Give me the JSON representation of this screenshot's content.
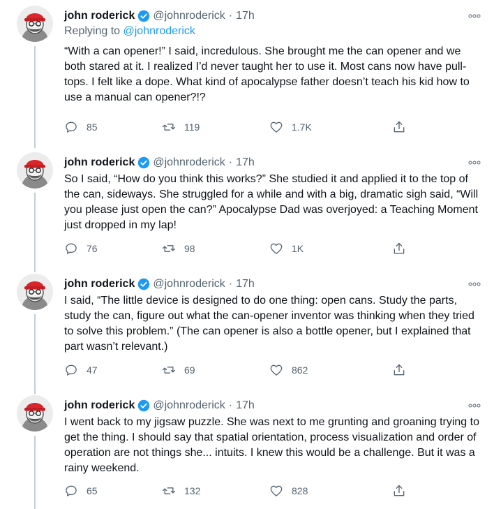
{
  "tweets": [
    {
      "author": "john roderick",
      "handle": "@johnroderick",
      "separator": "·",
      "time": "17h",
      "reply_prefix": "Replying to",
      "reply_to": "@johnroderick",
      "text": "“With a can opener!” I said, incredulous. She brought me the can opener and we both stared at it. I realized I’d never taught her to use it. Most cans now have pull-tops. I felt like a dope. What kind of apocalypse father doesn’t teach his kid how to use a manual can opener?!?",
      "replies": "85",
      "retweets": "119",
      "likes": "1.7K"
    },
    {
      "author": "john roderick",
      "handle": "@johnroderick",
      "separator": "·",
      "time": "17h",
      "text": "So I said, “How do you think this works?” She studied it and applied it to the top of the can, sideways. She struggled for a while and with a big, dramatic sigh said, “Will you please just open the can?” Apocalypse Dad was overjoyed: a Teaching Moment just dropped in my lap!",
      "replies": "76",
      "retweets": "98",
      "likes": "1K"
    },
    {
      "author": "john roderick",
      "handle": "@johnroderick",
      "separator": "·",
      "time": "17h",
      "text": "I said, “The little device is designed to do one thing: open cans. Study the parts, study the can, figure out what the can-opener inventor was thinking when they tried to solve this problem.” (The can opener is also a bottle opener, but I explained that part wasn’t relevant.)",
      "replies": "47",
      "retweets": "69",
      "likes": "862"
    },
    {
      "author": "john roderick",
      "handle": "@johnroderick",
      "separator": "·",
      "time": "17h",
      "text": "I went back to my jigsaw puzzle. She was next to me grunting and groaning trying to get the thing. I should say that spatial orientation, process visualization and order of operation are not things she... intuits. I knew this would be a challenge. But it was a rainy weekend.",
      "replies": "65",
      "retweets": "132",
      "likes": "828"
    }
  ],
  "colors": {
    "text": "#0f1419",
    "muted": "#536471",
    "accent": "#1d9bf0",
    "thread_line": "#c4cfd6",
    "hat": "#d9262c"
  },
  "icons": {
    "reply": "reply-icon",
    "retweet": "retweet-icon",
    "like": "like-icon",
    "share": "share-icon",
    "more": "more-icon",
    "verified": "verified-badge-icon"
  }
}
